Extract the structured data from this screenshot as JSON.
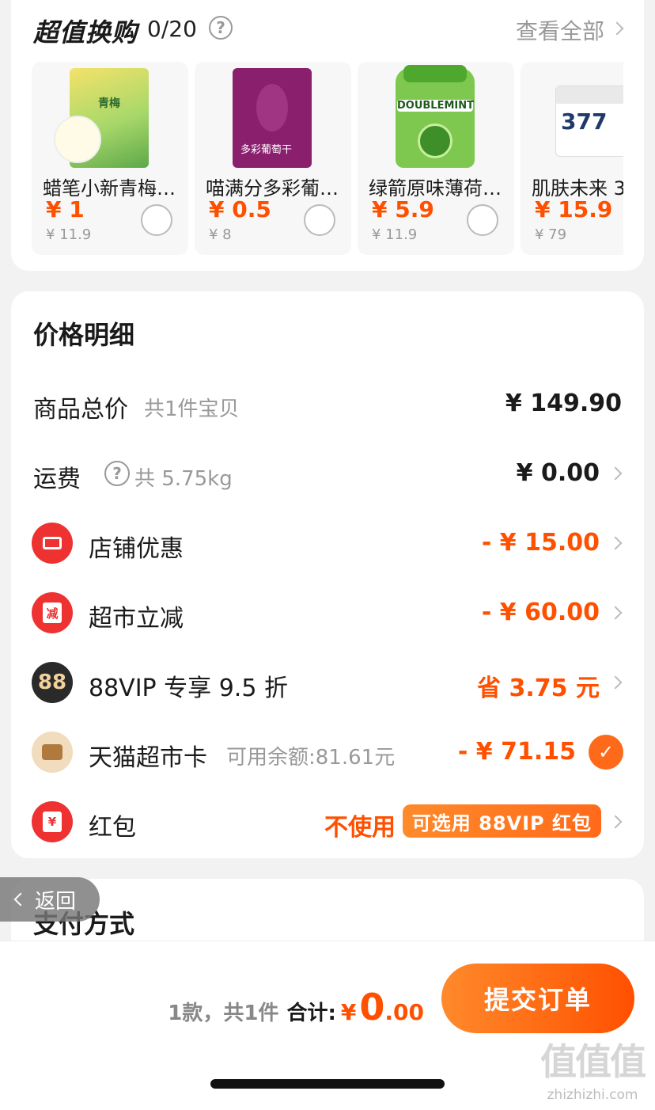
{
  "exchange": {
    "title": "超值换购",
    "count": "0/20",
    "help_icon": "?",
    "view_all": "查看全部",
    "products": [
      {
        "name": "蜡笔小新青梅…",
        "price": "¥ 1",
        "orig": "¥ 11.9",
        "img_text": "青梅"
      },
      {
        "name": "喵满分多彩葡…",
        "price": "¥ 0.5",
        "orig": "¥ 8",
        "img_text": "多彩葡萄干"
      },
      {
        "name": "绿箭原味薄荷…",
        "price": "¥ 5.9",
        "orig": "¥ 11.9",
        "img_text": "DOUBLEMINT"
      },
      {
        "name": "肌肤未来 3",
        "price": "¥ 15.9",
        "orig": "¥ 79",
        "img_text": "377"
      }
    ]
  },
  "detail": {
    "title": "价格明细",
    "goods_total": {
      "label": "商品总价",
      "sub": "共1件宝贝",
      "value": "¥ 149.90"
    },
    "shipping": {
      "label": "运费",
      "help_icon": "?",
      "sub": "共 5.75kg",
      "value": "¥ 0.00"
    },
    "shop_discount": {
      "label": "店铺优惠",
      "value": "- ¥ 15.00"
    },
    "market_cut": {
      "label": "超市立减",
      "icon_text": "减",
      "value": "- ¥ 60.00"
    },
    "vip": {
      "label": "88VIP 专享 9.5 折",
      "icon_text": "88",
      "value": "省 3.75 元"
    },
    "market_card": {
      "label": "天猫超市卡",
      "sub": "可用余额:81.61元",
      "value": "- ¥ 71.15",
      "check": "✓"
    },
    "red_packet": {
      "label": "红包",
      "icon_text": "¥",
      "unused": "不使用",
      "badge": "可选用 88VIP 红包"
    }
  },
  "payment": {
    "title": "支付方式"
  },
  "back": {
    "label": "返回"
  },
  "bottom": {
    "count": "1款，共1件",
    "total_label": "合计:",
    "yen": "¥",
    "total_int": "0",
    "total_dec": ".00",
    "submit": "提交订单"
  },
  "watermark": {
    "main": "值值值",
    "sub": "zhizhizhi.com"
  },
  "colors": {
    "accent": "#ff5000",
    "red_icon": "#ee3232",
    "check": "#ff6a1a"
  }
}
